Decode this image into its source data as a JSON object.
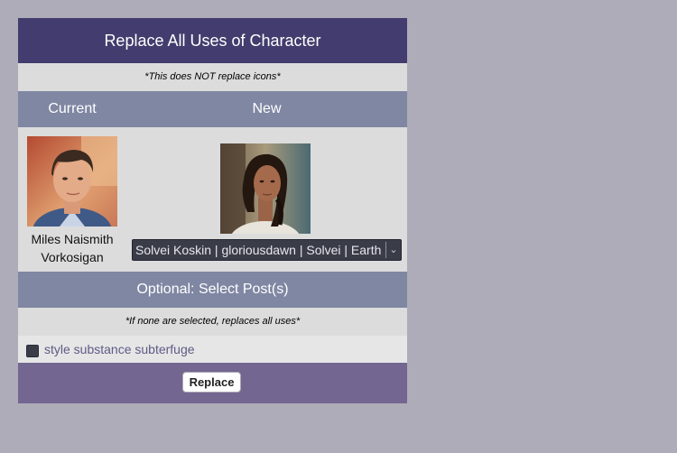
{
  "title": "Replace All Uses of Character",
  "icons_note": "*This does NOT replace icons*",
  "columns": {
    "current": "Current",
    "new": "New"
  },
  "current_character": {
    "name_line1": "Miles Naismith",
    "name_line2": "Vorkosigan"
  },
  "new_character": {
    "selected": "Solvei Koskin | gloriousdawn | Solvei | Earth"
  },
  "optional_header": "Optional: Select Post(s)",
  "optional_note": "*If none are selected, replaces all uses*",
  "posts": [
    {
      "label": "style substance subterfuge",
      "checked": false
    }
  ],
  "replace_button": "Replace",
  "colors": {
    "title_bg": "#433c6e",
    "header_bg": "#8087a3",
    "footer_bg": "#736690",
    "page_bg": "#adacb8",
    "panel_bg": "#dcdcdc",
    "post_link": "#5e5a86"
  }
}
